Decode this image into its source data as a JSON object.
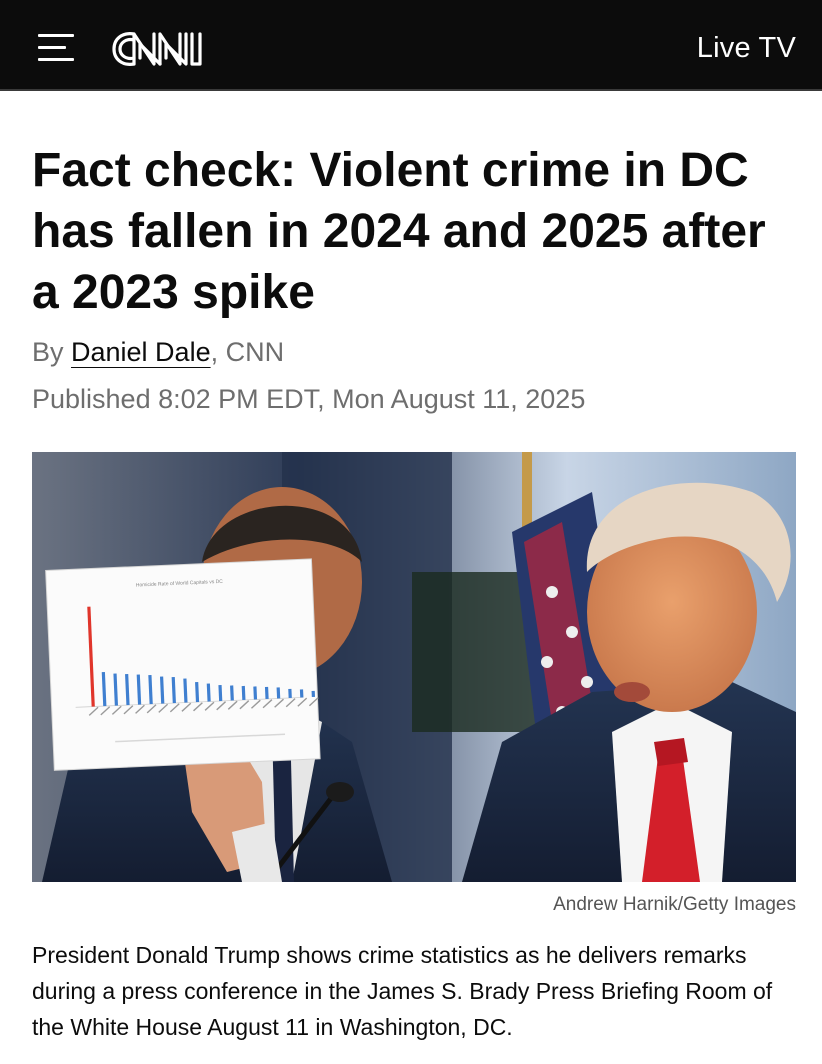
{
  "header": {
    "logo_text": "CNN",
    "live_tv_label": "Live TV"
  },
  "article": {
    "headline": "Fact check: Violent crime in DC has fallen in 2024 and 2025 after a 2023 spike",
    "byline_prefix": "By ",
    "author": "Daniel Dale",
    "byline_suffix": ", CNN",
    "published": "Published 8:02 PM EDT, Mon August 11, 2025"
  },
  "photo": {
    "credit": "Andrew Harnik/Getty Images",
    "caption": "President Donald Trump shows crime statistics as he delivers remarks during a press conference in the James S. Brady Press Briefing Room of the White House August 11 in Washington, DC.",
    "held_chart": {
      "title": "Homicide Rate of World Capitals vs DC",
      "highlight_color": "#e0352b",
      "bar_color": "#3f7fd0",
      "bar_levels": [
        1.0,
        0.34,
        0.32,
        0.31,
        0.3,
        0.29,
        0.27,
        0.26,
        0.24,
        0.2,
        0.18,
        0.16,
        0.15,
        0.14,
        0.13,
        0.12,
        0.11,
        0.09,
        0.08,
        0.06
      ]
    }
  },
  "colors": {
    "topbar": "#0c0c0c",
    "text": "#0c0c0c",
    "muted": "#6e6e6e",
    "tie_red": "#d31f2a"
  }
}
